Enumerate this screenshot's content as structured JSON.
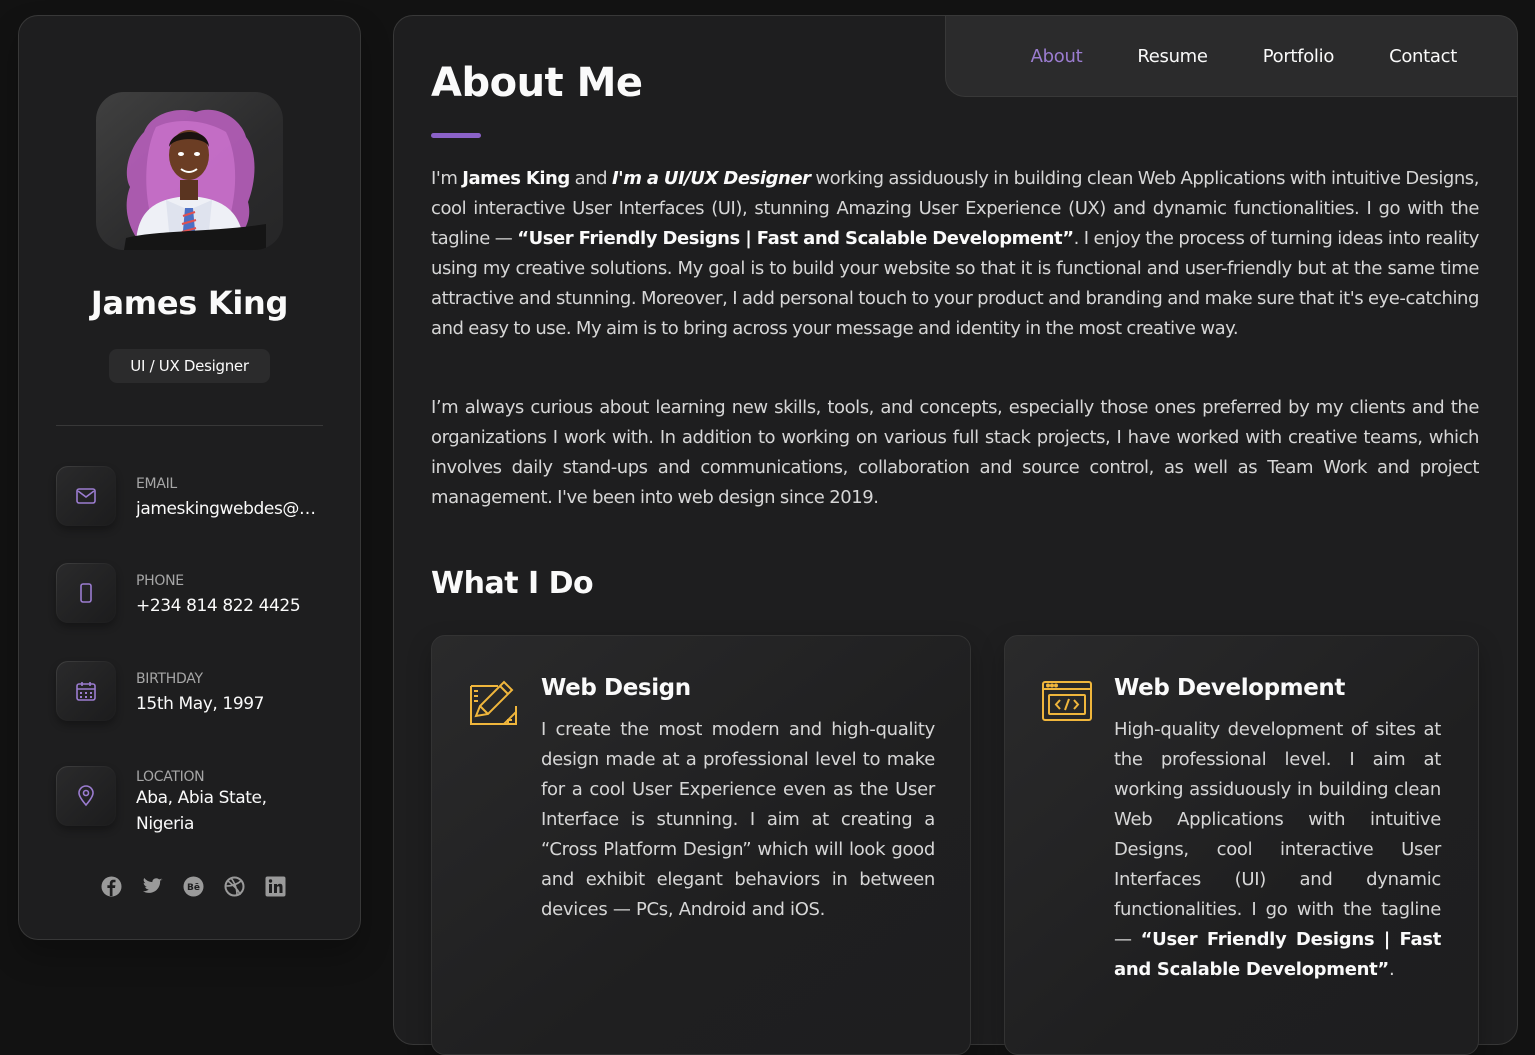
{
  "profile": {
    "name": "James King",
    "title": "UI / UX Designer"
  },
  "contacts": [
    {
      "label": "EMAIL",
      "value": "jameskingwebdes@gmail.com",
      "icon": "mail-icon"
    },
    {
      "label": "PHONE",
      "value": "+234 814 822 4425",
      "icon": "phone-icon"
    },
    {
      "label": "BIRTHDAY",
      "value": "15th May, 1997",
      "icon": "calendar-icon"
    },
    {
      "label": "LOCATION",
      "value": "Aba, Abia State, Nigeria",
      "icon": "location-pin-icon"
    }
  ],
  "socials": [
    "facebook-icon",
    "twitter-icon",
    "behance-icon",
    "dribbble-icon",
    "linkedin-icon"
  ],
  "nav": {
    "items": [
      "About",
      "Resume",
      "Portfolio",
      "Contact"
    ],
    "active": "About"
  },
  "about": {
    "heading": "About Me",
    "p1": {
      "t1": "I'm ",
      "name": "James King",
      "t2": " and ",
      "role": "I'm a UI/UX Designer",
      "t3": " working assiduously in building clean Web Applications with intuitive Designs, cool interactive User Interfaces (UI), stunning Amazing User Experience (UX) and dynamic functionalities. I go with the tagline — ",
      "tagline": "“User Friendly Designs | Fast and Scalable Development”",
      "t4": ". I enjoy the process of turning ideas into reality using my creative solutions. My goal is to build your website so that it is functional and user-friendly but at the same time attractive and stunning. Moreover, I add personal touch to your product and branding and make sure that it's eye-catching and easy to use. My aim is to bring across your message and identity in the most creative way."
    },
    "p2": "I’m always curious about learning new skills, tools, and concepts, especially those ones preferred by my clients and the organizations I work with. In addition to working on various full stack projects, I have worked with creative teams, which involves daily stand-ups and communications, collaboration and source control, as well as Team Work and project management. I've been into web design since 2019."
  },
  "services": {
    "heading": "What I Do",
    "items": [
      {
        "title": "Web Design",
        "icon": "design-tools-icon",
        "text": "I create the most modern and high-quality design made at a professional level to make for a cool User Experience even as the User Interface is stunning. I aim at creating a “Cross Platform Design” which will look good and exhibit elegant behaviors in between devices — PCs, Android and iOS."
      },
      {
        "title": "Web Development",
        "icon": "code-window-icon",
        "text": "High-quality development of sites at the professional level. I aim at working assiduously in building clean Web Applications with intuitive Designs, cool interactive User Interfaces (UI) and dynamic functionalities. I go with the tagline — ",
        "tagline": "“User Friendly Designs | Fast and Scalable Development”",
        "end": "."
      }
    ]
  },
  "colors": {
    "accent": "#9b7cd0",
    "accent_bar": "#8b62c8",
    "icon_gold": "#f0b63c",
    "background": "#121212",
    "card": "#1e1e1f"
  }
}
